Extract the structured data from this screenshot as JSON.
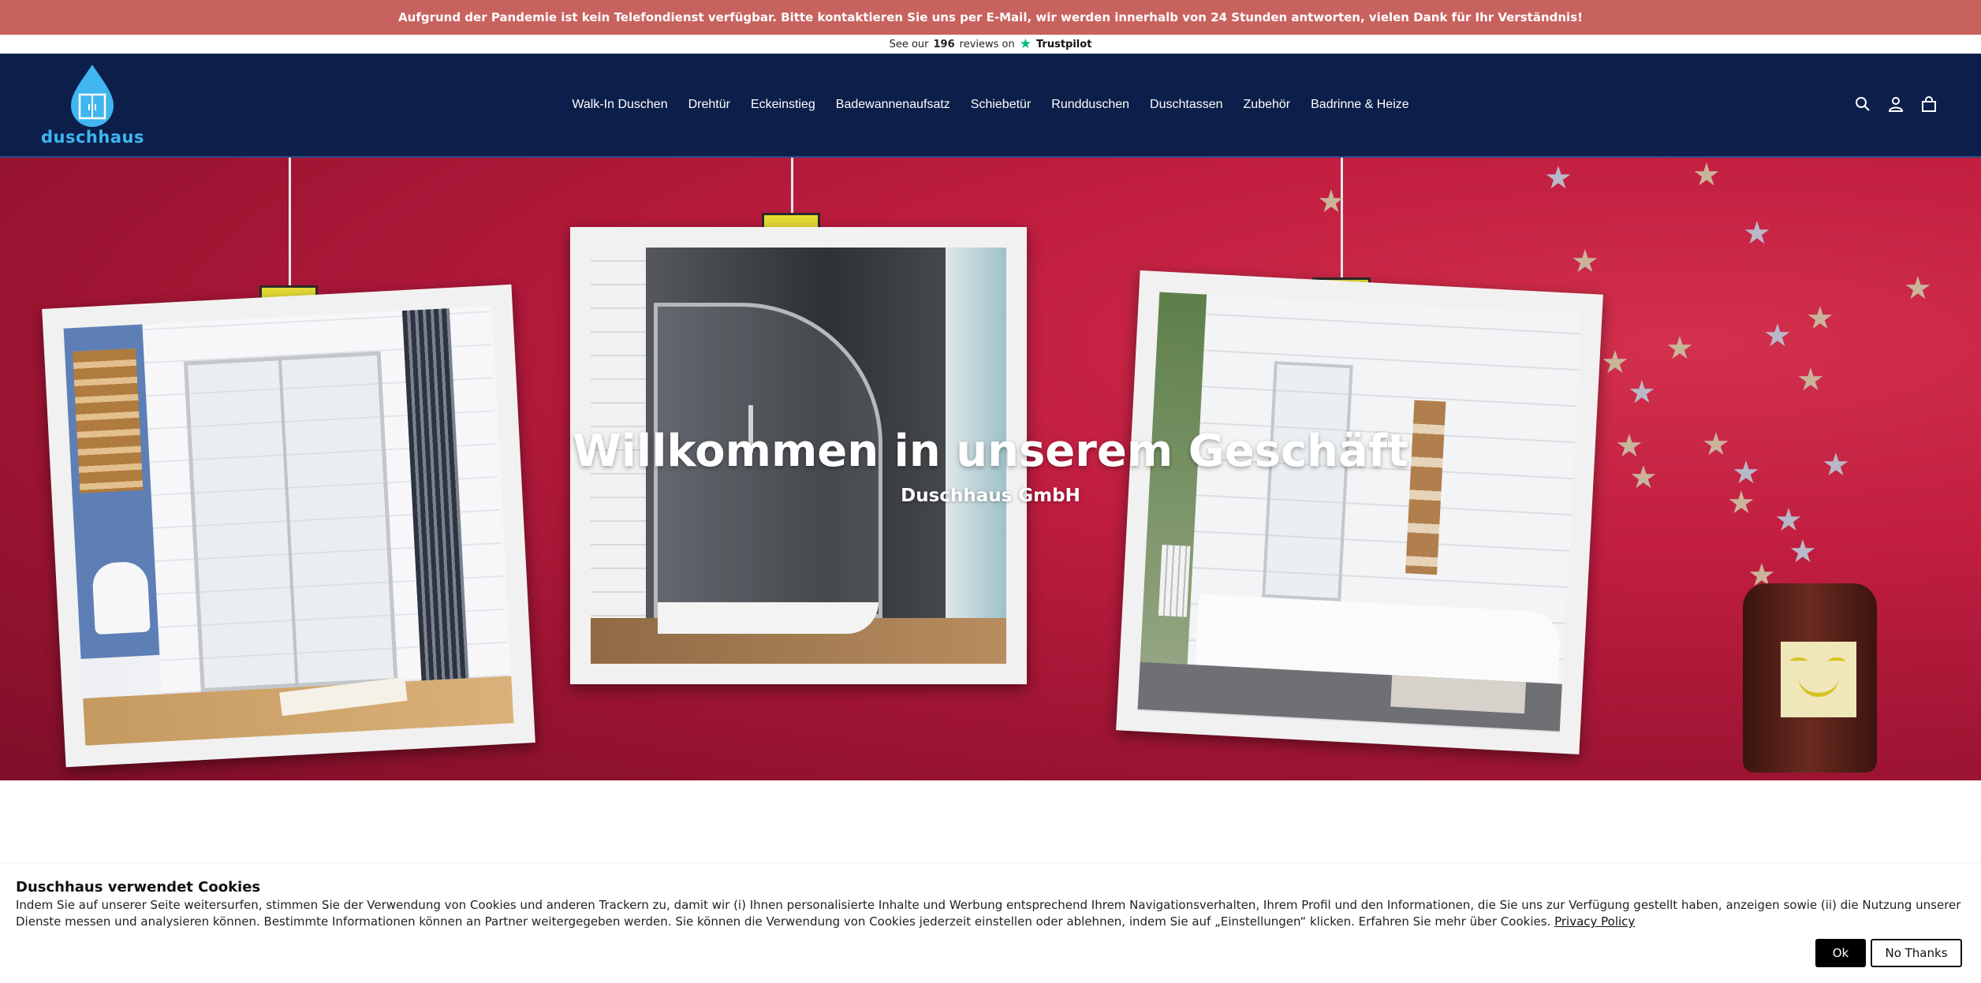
{
  "announcement": {
    "text": "Aufgrund der Pandemie ist kein Telefondienst verfügbar. Bitte kontaktieren Sie uns per E-Mail, wir werden innerhalb von 24 Stunden antworten, vielen Dank für Ihr Verständnis!"
  },
  "trustbar": {
    "prefix": "See our",
    "count": "196",
    "suffix": "reviews on",
    "brand": "Trustpilot"
  },
  "header": {
    "logo_text": "duschhaus",
    "nav": [
      "Walk-In Duschen",
      "Drehtür",
      "Eckeinstieg",
      "Badewannenaufsatz",
      "Schiebetür",
      "Rundduschen",
      "Duschtassen",
      "Zubehör",
      "Badrinne & Heize"
    ],
    "icons": [
      "search-icon",
      "account-icon",
      "cart-icon"
    ],
    "colors": {
      "background": "#0b1f4a",
      "logo": "#3fb6f0"
    }
  },
  "hero": {
    "title": "Willkommen in unserem Geschäft",
    "subtitle": "Duschhaus GmbH",
    "colors": {
      "background": "#b3183a",
      "tag": "#e6de35"
    }
  },
  "cookie": {
    "title": "Duschhaus verwendet Cookies",
    "body": "Indem Sie auf unserer Seite weitersurfen, stimmen Sie der Verwendung von Cookies und anderen Trackern zu, damit wir (i) Ihnen personalisierte Inhalte und Werbung entsprechend Ihrem Navigationsverhalten, Ihrem Profil und den Informationen, die Sie uns zur Verfügung gestellt haben, anzeigen sowie (ii) die Nutzung unserer Dienste messen und analysieren können. Bestimmte Informationen können an Partner weitergegeben werden. Sie können die Verwendung von Cookies jederzeit einstellen oder ablehnen, indem Sie auf „Einstellungen“ klicken. Erfahren Sie mehr über Cookies.",
    "link": "Privacy Policy",
    "ok_label": "Ok",
    "no_label": "No Thanks"
  }
}
